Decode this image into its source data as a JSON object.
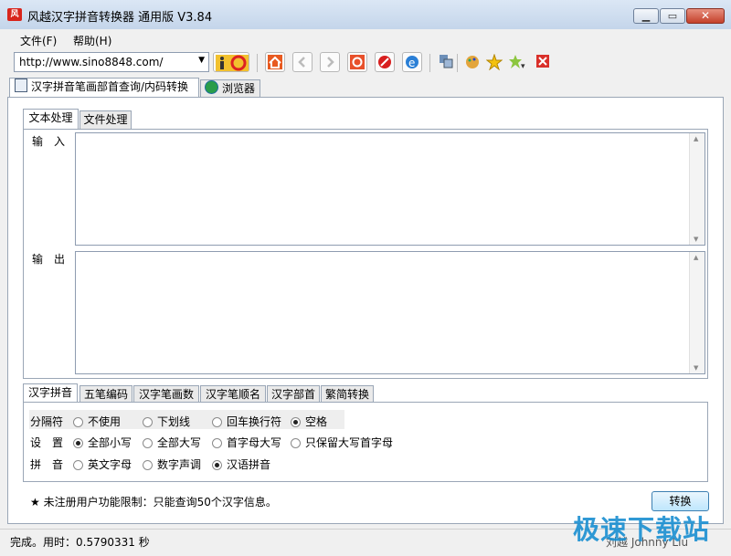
{
  "window": {
    "title": "风越汉字拼音转换器 通用版 V3.84"
  },
  "menu": {
    "file": "文件(F)",
    "help": "帮助(H)"
  },
  "toolbar": {
    "url": "http://www.sino8848.com/"
  },
  "main_tabs": [
    "汉字拼音笔画部首查询/内码转换",
    "浏览器"
  ],
  "inner_tabs": [
    "文本处理",
    "文件处理"
  ],
  "labels": {
    "input": "输　入",
    "output": "输　出"
  },
  "option_tabs": [
    "汉字拼音",
    "五笔编码",
    "汉字笔画数",
    "汉字笔顺名",
    "汉字部首",
    "繁简转换"
  ],
  "options": {
    "separator": {
      "label": "分隔符",
      "choices": [
        "不使用",
        "下划线",
        "回车换行符",
        "空格"
      ],
      "selected": "空格"
    },
    "setting": {
      "label": "设　置",
      "choices": [
        "全部小写",
        "全部大写",
        "首字母大写",
        "只保留大写首字母"
      ],
      "selected": "全部小写"
    },
    "pinyin": {
      "label": "拼　音",
      "choices": [
        "英文字母",
        "数字声调",
        "汉语拼音"
      ],
      "selected": "汉语拼音"
    }
  },
  "notice": "★ 未注册用户功能限制：只能查询50个汉字信息。",
  "convert_button": "转换",
  "status": {
    "text": "完成。用时：0.5790331 秒",
    "author": "刘越 Johnny Liu"
  },
  "watermark": "极速下载站"
}
